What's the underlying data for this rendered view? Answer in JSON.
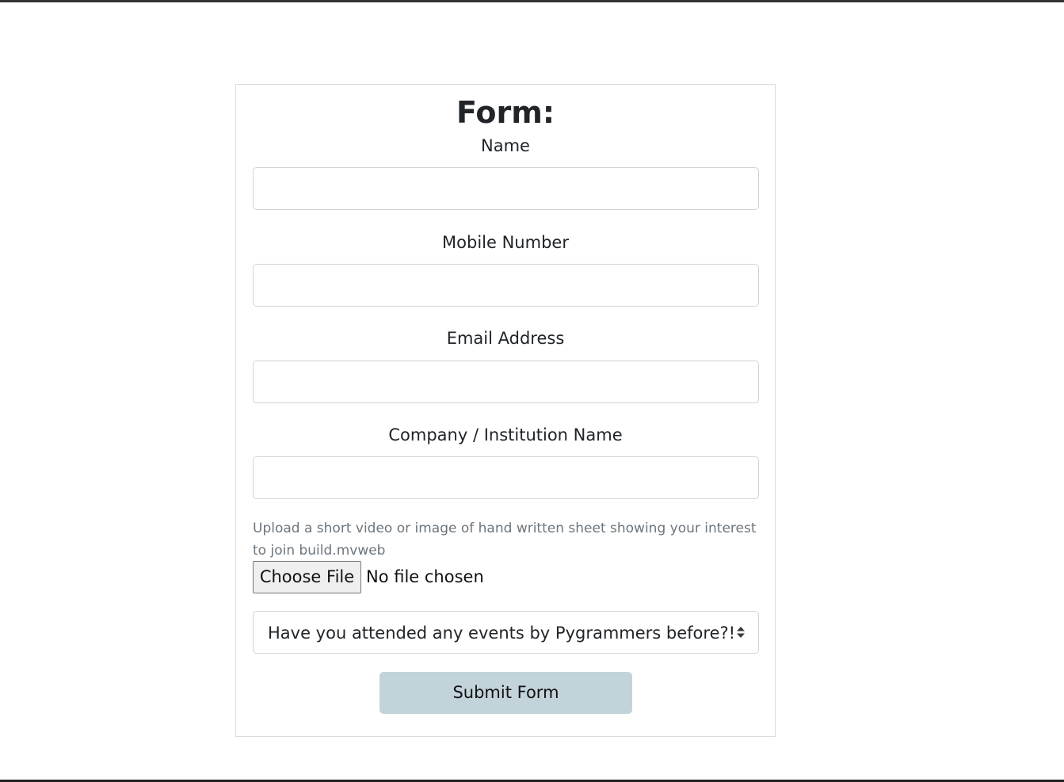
{
  "form": {
    "title": "Form:",
    "fields": [
      {
        "label": "Name",
        "value": "",
        "placeholder": ""
      },
      {
        "label": "Mobile Number",
        "value": "",
        "placeholder": ""
      },
      {
        "label": "Email Address",
        "value": "",
        "placeholder": ""
      },
      {
        "label": "Company / Institution Name",
        "value": "",
        "placeholder": ""
      }
    ],
    "upload": {
      "help_text": "Upload a short video or image of hand written sheet showing your interest to join build.mvweb",
      "button_label": "Choose File",
      "status": "No file chosen"
    },
    "select": {
      "selected": "Have you attended any events by Pygrammers before?!",
      "icon": "select-arrows-icon"
    },
    "submit_label": "Submit Form"
  },
  "colors": {
    "submit_bg": "#c3d3da",
    "border": "#ced4da",
    "help_text": "#6c757d"
  }
}
